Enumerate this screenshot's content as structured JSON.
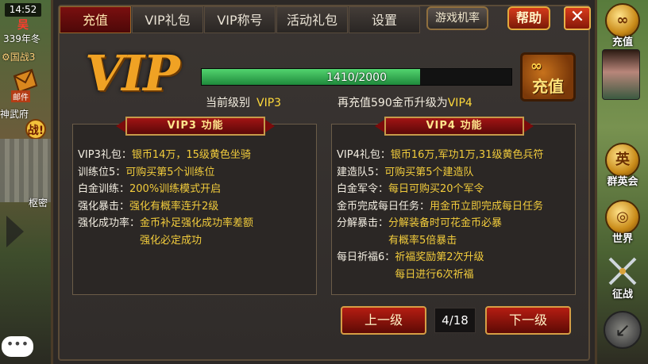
{
  "status": {
    "time": "14:52",
    "faction": "吴",
    "year": "339年冬",
    "guozhan": "国战3"
  },
  "left": {
    "mail_label": "邮件",
    "city": "神武府",
    "battle": "战!",
    "shumi": "枢密",
    "chat": "•••"
  },
  "right": {
    "recharge_label": "充值",
    "heroes_label": "群英会",
    "world_label": "世界",
    "campaign_label": "征战",
    "back": "↙"
  },
  "tabs": [
    {
      "label": "充值",
      "active": true
    },
    {
      "label": "VIP礼包",
      "active": false
    },
    {
      "label": "VIP称号",
      "active": false
    },
    {
      "label": "活动礼包",
      "active": false
    },
    {
      "label": "设置",
      "active": false
    }
  ],
  "header": {
    "game_rate": "游戏机率",
    "help": "帮助",
    "close": "✕"
  },
  "vip": {
    "logo": "VIP",
    "progress_text": "1410/2000",
    "progress_value": 1410,
    "progress_max": 2000,
    "current_label": "当前级别",
    "current_level": "VIP3",
    "upgrade_text": "再充值590金币升级为",
    "next_level": "VIP4",
    "recharge_button": "充值",
    "coins": "∞"
  },
  "left_box": {
    "title": "VIP3 功能",
    "rows": [
      {
        "k": "VIP3礼包：",
        "v": "银币14万，15级黄色坐骑"
      },
      {
        "k": "训练位5：",
        "v": "可购买第5个训练位"
      },
      {
        "k": "白金训练：",
        "v": "200%训练模式开启"
      },
      {
        "k": "强化暴击：",
        "v": "强化有概率连升2级"
      },
      {
        "k": "强化成功率：",
        "v": "金币补足强化成功率差额"
      },
      {
        "k": "",
        "v": "强化必定成功"
      }
    ]
  },
  "right_box": {
    "title": "VIP4 功能",
    "rows": [
      {
        "k": "VIP4礼包：",
        "v": "银币16万,军功1万,31级黄色兵符"
      },
      {
        "k": "建造队5：",
        "v": "可购买第5个建造队"
      },
      {
        "k": "白金军令：",
        "v": "每日可购买20个军令"
      },
      {
        "k": "金币完成每日任务：",
        "v": "用金币立即完成每日任务"
      },
      {
        "k": "分解暴击：",
        "v": "分解装备时可花金币必暴"
      },
      {
        "k": "",
        "v": "有概率5倍暴击"
      },
      {
        "k": "每日祈福6：",
        "v": "祈福奖励第2次升级"
      },
      {
        "k": "",
        "v": "每日进行6次祈福"
      }
    ]
  },
  "pager": {
    "prev": "上一级",
    "page": "4/18",
    "next": "下一级"
  },
  "colors": {
    "accent_gold": "#ffd93b",
    "tab_active": "#7a0f0f",
    "progress": "#52d46e"
  }
}
